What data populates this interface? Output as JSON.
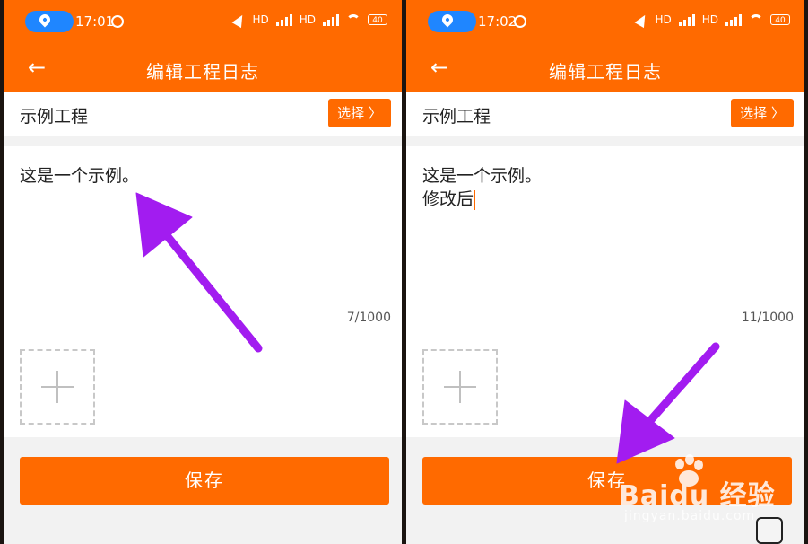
{
  "left_phone": {
    "status": {
      "time": "17:01",
      "hd1": "HD",
      "hd2": "HD",
      "battery": "40"
    },
    "appbar": {
      "title": "编辑工程日志"
    },
    "project": {
      "name": "示例工程",
      "choose_label": "选择 〉"
    },
    "editor": {
      "content": "这是一个示例。",
      "counter": "7/1000"
    },
    "save_label": "保存"
  },
  "right_phone": {
    "status": {
      "time": "17:02",
      "hd1": "HD",
      "hd2": "HD",
      "battery": "40"
    },
    "appbar": {
      "title": "编辑工程日志"
    },
    "project": {
      "name": "示例工程",
      "choose_label": "选择 〉"
    },
    "editor": {
      "content": "这是一个示例。\n修改后",
      "counter": "11/1000"
    },
    "save_label": "保存"
  },
  "watermark": {
    "brand": "Baidu 经验",
    "url": "jingyan.baidu.com"
  },
  "colors": {
    "accent": "#ff6a00",
    "annotation_arrow": "#a21cf0",
    "location_pill": "#1f86ff"
  }
}
